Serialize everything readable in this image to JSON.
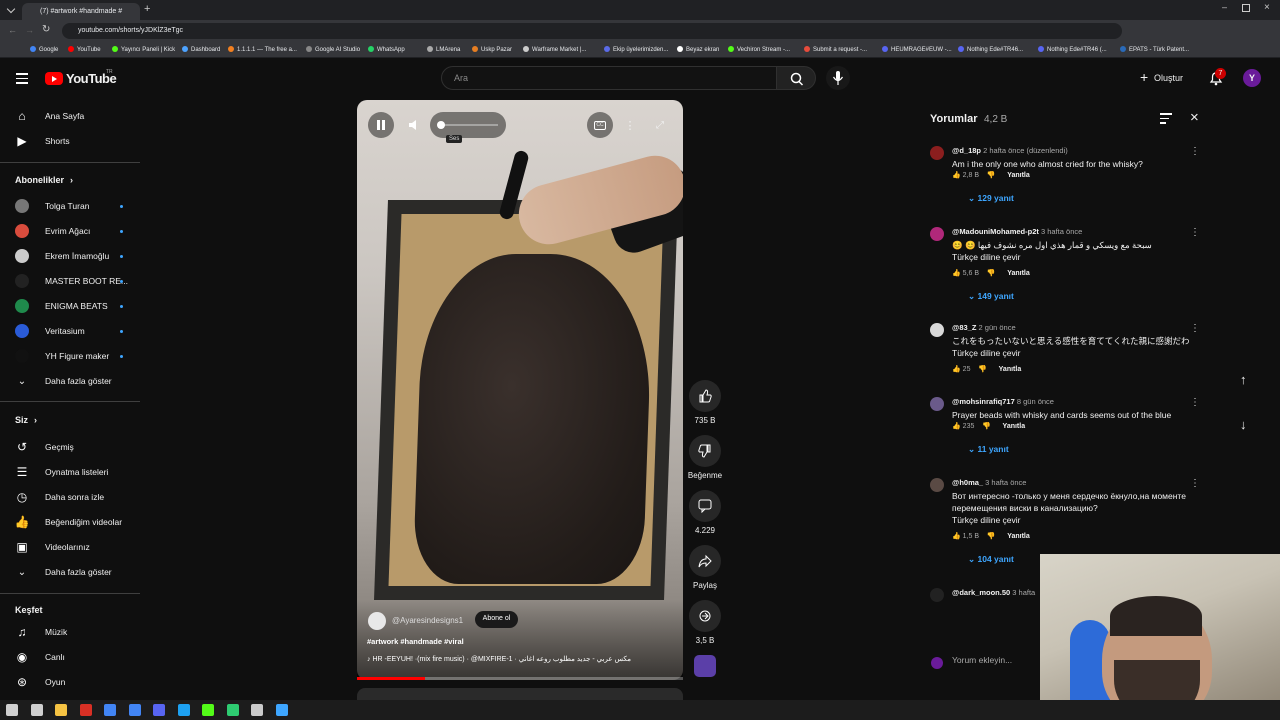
{
  "browser": {
    "tab_title": "(7) #artwork #handmade #",
    "url": "youtube.com/shorts/yJDKlZ3eTgc",
    "bookmarks": [
      "Google",
      "YouTube",
      "Yayıncı Paneli | Kick",
      "Dashboard",
      "1.1.1.1 — The free a...",
      "Google AI Studio",
      "WhatsApp",
      "LMArena",
      "Uskp Pazar",
      "Warframe Market |...",
      "Ekip üyelerimizden...",
      "Beyaz ekran",
      "Vechiron Stream -...",
      "Submit a request -...",
      "HEUMRAGE#EUW -...",
      "Nothing Ede#TR46...",
      "Nothing Ede#TR46 (...",
      "EPATS - Türk Patent..."
    ]
  },
  "header": {
    "logo_text": "YouTube",
    "logo_region": "TR",
    "search_placeholder": "Ara",
    "create_label": "Oluştur",
    "notif_count": "7",
    "avatar_letter": "Y",
    "colors": {
      "brand": "#ff0000",
      "accent": "#3ea6ff"
    }
  },
  "sidebar": {
    "main": [
      {
        "label": "Ana Sayfa",
        "icon": "home-icon"
      },
      {
        "label": "Shorts",
        "icon": "shorts-icon"
      }
    ],
    "subs_title": "Abonelikler",
    "subs": [
      {
        "label": "Tolga Turan",
        "color": "#777777"
      },
      {
        "label": "Evrim Ağacı",
        "color": "#d94c3d"
      },
      {
        "label": "Ekrem İmamoğlu",
        "color": "#cccccc"
      },
      {
        "label": "MASTER BOOT RE...",
        "color": "#222222"
      },
      {
        "label": "ENIGMA BEATS",
        "color": "#1f8a4c"
      },
      {
        "label": "Veritasium",
        "color": "#2a5bd7"
      },
      {
        "label": "YH Figure maker",
        "color": "#111111"
      }
    ],
    "subs_more": "Daha fazla göster",
    "you_title": "Siz",
    "you": [
      {
        "label": "Geçmiş",
        "icon": "history-icon"
      },
      {
        "label": "Oynatma listeleri",
        "icon": "playlist-icon"
      },
      {
        "label": "Daha sonra izle",
        "icon": "clock-icon"
      },
      {
        "label": "Beğendiğim videolar",
        "icon": "like-icon"
      },
      {
        "label": "Videolarınız",
        "icon": "video-icon"
      }
    ],
    "you_more": "Daha fazla göster",
    "explore_title": "Keşfet",
    "explore": [
      {
        "label": "Müzik",
        "icon": "music-icon"
      },
      {
        "label": "Canlı",
        "icon": "live-icon"
      },
      {
        "label": "Oyun",
        "icon": "game-icon"
      }
    ]
  },
  "video": {
    "channel": "@Ayaresindesigns1",
    "subscribe_label": "Abone ol",
    "tags": "#artwork #handmade #viral",
    "music": "HR -EEYUH! ·(mix fire music) · @MIXFIRE-1 · مكس عربي - جديد مطلوب روعه اغاني",
    "volume_tooltip": "Ses",
    "progress": 0.21
  },
  "actions": {
    "likes": "735 B",
    "dislike_label": "Beğenme",
    "comments": "4.229",
    "share_label": "Paylaş",
    "remix": "3,5 B"
  },
  "comments": {
    "title": "Yorumlar",
    "count": "4,2 B",
    "translate_label": "Türkçe diline çevir",
    "reply_label": "Yanıtla",
    "input_placeholder": "Yorum ekleyin...",
    "items": [
      {
        "user": "@d_18p",
        "time": "2 hafta önce (düzenlendi)",
        "text": "Am i the only one who almost cried for the whisky?",
        "likes": "2,8 B",
        "replies": "129 yanıt",
        "translate": false,
        "avatar": "#8b1e1e"
      },
      {
        "user": "@MadouniMohamed-p2t",
        "time": "3 hafta önce",
        "text": "😊 😊 سبحة مع ويسكي و قمار هذي اول مره نشوف فيها",
        "likes": "5,6 B",
        "replies": "149 yanıt",
        "translate": true,
        "avatar": "#b0287a"
      },
      {
        "user": "@83_Z",
        "time": "2 gün önce",
        "text": "これをもったいないと思える感性を育ててくれた親に感謝だわ",
        "likes": "25",
        "replies": "",
        "translate": true,
        "avatar": "#d8d8d8"
      },
      {
        "user": "@mohsinrafiq717",
        "time": "8 gün önce",
        "text": "Prayer beads with whisky and cards seems out of the blue",
        "likes": "235",
        "replies": "11 yanıt",
        "translate": false,
        "avatar": "#6a5a8a"
      },
      {
        "user": "@h0ma_",
        "time": "3 hafta önce",
        "text": "Вот интересно -только у меня сердечко ёкнуло,на моменте перемещения виски в канализацию?",
        "likes": "1,5 B",
        "replies": "104 yanıt",
        "translate": true,
        "avatar": "#5a4a44"
      },
      {
        "user": "@dark_moon.50",
        "time": "3 hafta",
        "text": "",
        "likes": "",
        "replies": "",
        "translate": false,
        "avatar": "#222222"
      }
    ]
  }
}
